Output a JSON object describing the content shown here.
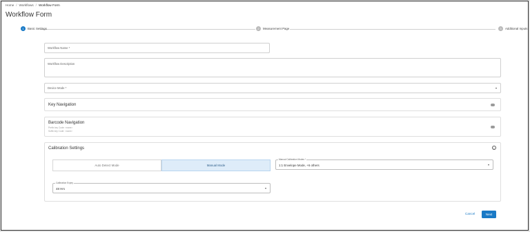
{
  "breadcrumb": {
    "items": [
      "Home",
      "Workflows",
      "Workflow Form"
    ]
  },
  "page": {
    "title": "Workflow Form"
  },
  "stepper": {
    "steps": [
      {
        "number": "1",
        "label": "Basic Settings",
        "state": "active"
      },
      {
        "number": "2",
        "label": "Measurement Page",
        "state": "pending"
      },
      {
        "number": "3",
        "label": "Additional Inputs",
        "state": "pending"
      }
    ]
  },
  "form": {
    "workflow_name_label": "Workflow Name *",
    "workflow_description_label": "Workflow Description",
    "device_mode_label": "Device Mode *"
  },
  "key_navigation": {
    "title": "Key Navigation",
    "toggle_icon": "toggle-icon"
  },
  "barcode_navigation": {
    "title": "Barcode Navigation",
    "prefix_line": "Prefix key Code: <none>",
    "suffix_line": "Suffix key Code: <none>",
    "toggle_icon": "toggle-icon"
  },
  "calibration": {
    "title": "Calibration Settings",
    "info_icon": "info-icon",
    "modes": [
      "Auto Detect Mode",
      "Manual Mode"
    ],
    "selected_mode": "Manual Mode",
    "manual_modes_label": "Manual Calibration Modes *",
    "manual_modes_value": "1:1 Envelope Mode, +6 others",
    "expiry_label": "Calibration Expiry",
    "expiry_value": "48 Hrs"
  },
  "actions": {
    "cancel_label": "Cancel",
    "next_label": "Next"
  },
  "colors": {
    "primary": "#1a7ac6",
    "selected_mode_bg": "#deecf9",
    "pending_step": "#b9b9b9"
  }
}
